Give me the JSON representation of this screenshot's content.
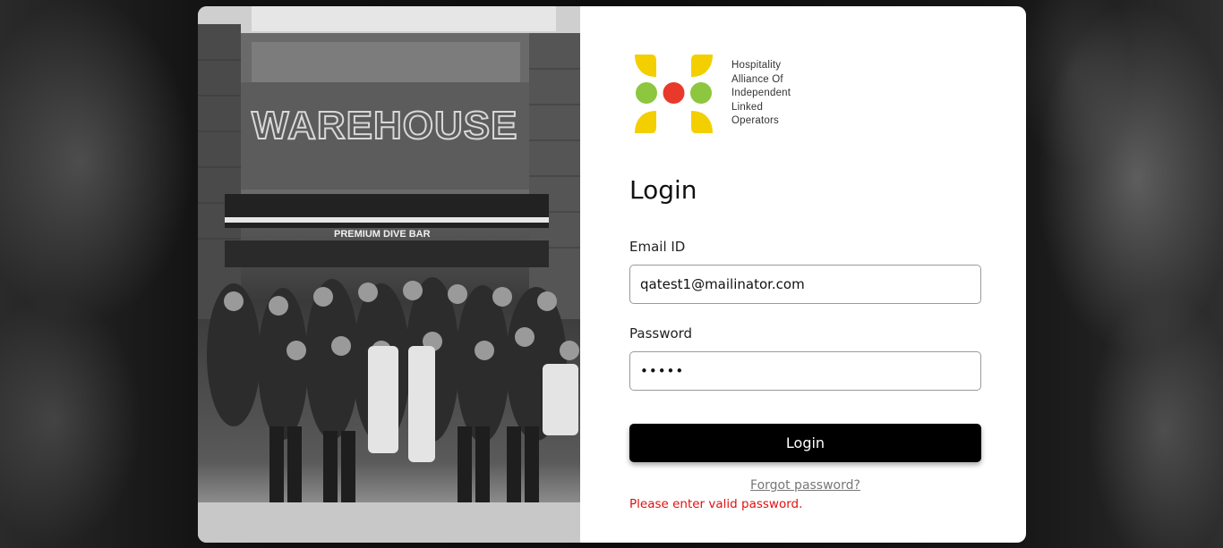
{
  "brand": {
    "name_lines": [
      "Hospitality",
      "Alliance Of",
      "Independent",
      "Linked",
      "Operators"
    ],
    "colors": {
      "yellow": "#f4cf00",
      "green": "#8dc63f",
      "red": "#e8392b"
    }
  },
  "photo": {
    "sign_text": "WAREHOUSE",
    "awning_text": "PREMIUM DIVE BAR"
  },
  "login": {
    "title": "Login",
    "email_label": "Email ID",
    "email_value": "qatest1@mailinator.com",
    "password_label": "Password",
    "password_value": "•••••",
    "submit_label": "Login",
    "forgot_label": "Forgot password?",
    "error_text": "Please enter valid password."
  }
}
